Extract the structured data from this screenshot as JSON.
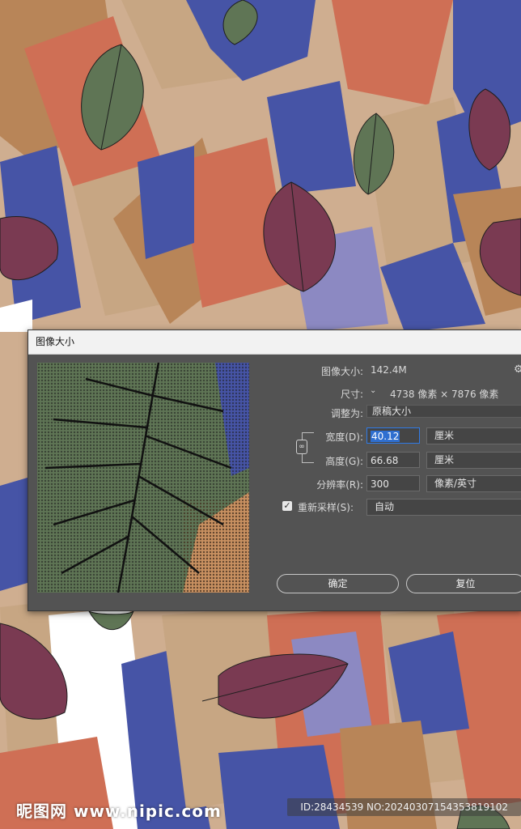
{
  "dialog": {
    "title": "图像大小",
    "image_size_label": "图像大小:",
    "image_size_value": "142.4M",
    "dimensions_label": "尺寸:",
    "dimensions_value": "4738 像素 × 7876 像素",
    "fit_to_label": "调整为:",
    "fit_to_value": "原稿大小",
    "width_label": "宽度(D):",
    "width_value": "40.12",
    "width_unit": "厘米",
    "height_label": "高度(G):",
    "height_value": "66.68",
    "height_unit": "厘米",
    "resolution_label": "分辨率(R):",
    "resolution_value": "300",
    "resolution_unit": "像素/英寸",
    "resample_label": "重新采样(S):",
    "resample_checked": true,
    "resample_value": "自动",
    "ok_label": "确定",
    "reset_label": "复位"
  },
  "watermark": {
    "site": "昵图网 www.nipic.com",
    "id": "ID:28434539 NO:20240307154353819102"
  },
  "colors": {
    "dialog_bg": "#535353",
    "accent": "#2f7ae5",
    "leaf_green": "#5f7555",
    "leaf_maroon": "#7a3a52",
    "block_blue": "#4654a6",
    "block_orange": "#cf6f55"
  }
}
